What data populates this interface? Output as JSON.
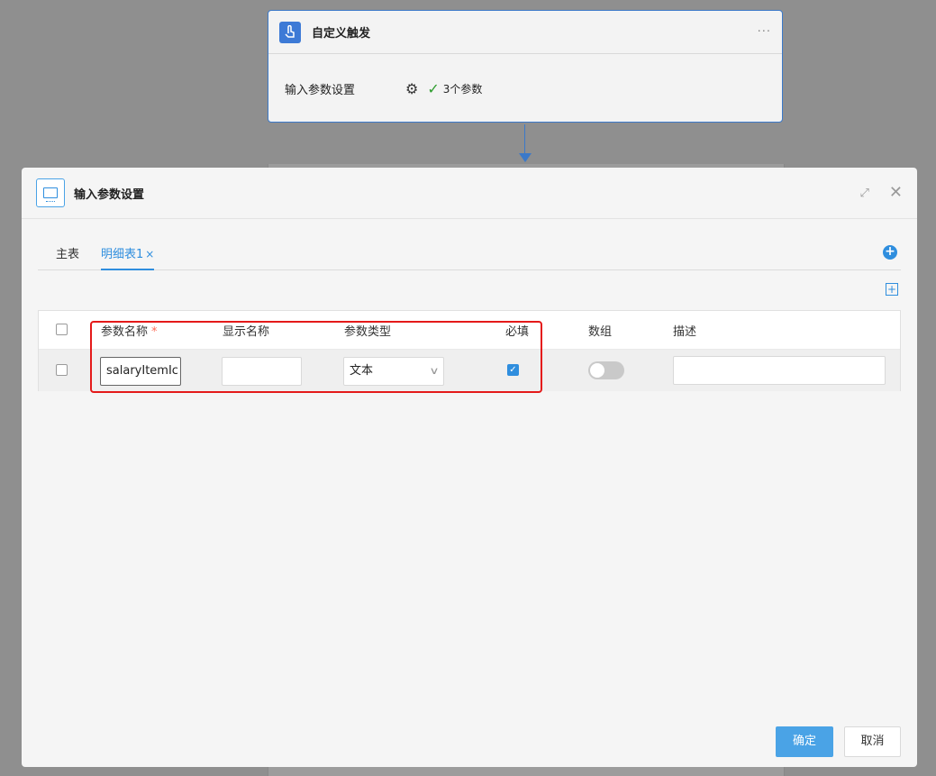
{
  "canvas": {
    "trigger_node": {
      "icon": "touch-hand-icon",
      "title": "自定义触发",
      "more": "···",
      "param_label": "输入参数设置",
      "param_count": "3个参数"
    }
  },
  "modal": {
    "icon": "screen-icon",
    "title": "输入参数设置",
    "tabs": [
      {
        "label": "主表"
      },
      {
        "label": "明细表1",
        "close": "×"
      }
    ],
    "add_tab_symbol": "+",
    "add_row_symbol": "+",
    "table": {
      "headers": {
        "name": "参数名称",
        "required_mark": "*",
        "display_name": "显示名称",
        "type": "参数类型",
        "required": "必填",
        "array": "数组",
        "description": "描述"
      },
      "rows": [
        {
          "selected": false,
          "name": "salaryItemIc",
          "display_name": "",
          "type": "文本",
          "required": true,
          "array": false,
          "description": ""
        }
      ]
    },
    "buttons": {
      "ok": "确定",
      "cancel": "取消"
    }
  },
  "colors": {
    "accent": "#2f8ede",
    "highlight_box": "#e41a1a",
    "overlay": "#8f8f8f"
  }
}
